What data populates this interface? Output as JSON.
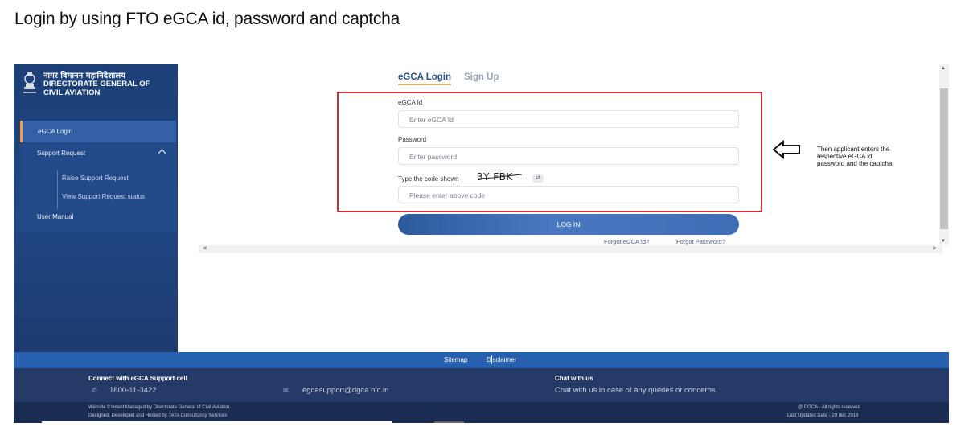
{
  "slide_title": "Login by using FTO eGCA id, password and captcha",
  "brand": {
    "hindi": "नागर विमानन महानिदेशालय",
    "line1": "DIRECTORATE GENERAL OF",
    "line2": "CIVIL AVIATION"
  },
  "sidebar": {
    "items": [
      {
        "label": "eGCA Login"
      },
      {
        "label": "Support Request"
      },
      {
        "label": "Raise Support Request"
      },
      {
        "label": "View Support Request status"
      },
      {
        "label": "User Manual"
      }
    ]
  },
  "tabs": {
    "login": "eGCA Login",
    "signup": "Sign Up"
  },
  "form": {
    "id_label": "eGCA Id",
    "id_placeholder": "Enter eGCA Id",
    "password_label": "Password",
    "password_placeholder": "Enter password",
    "captcha_label": "Type the code shown",
    "captcha_code": "3Y FBK",
    "captcha_placeholder": "Please enter above code",
    "login_button": "LOG IN",
    "forgot_id": "Forgot eGCA Id?",
    "forgot_password": "Forgot Password?"
  },
  "annotation": {
    "note": "Then applicant enters the respective eGCA id, password and the captcha"
  },
  "footer": {
    "sitemap": "Sitemap",
    "disclaimer": "Disclaimer",
    "support_heading": "Connect with eGCA Support cell",
    "phone": "1800-11-3422",
    "email": "egcasupport@dgca.nic.in",
    "chat_heading": "Chat with us",
    "chat_text": "Chat with us in case of any queries or concerns.",
    "managed_by": "Website Content Managed by Directorate General of Civil Aviation.",
    "hosted_by": "Designed, Developed and Hosted by TATA Consultancy Services",
    "rights": "@ DGCA - All rights reserved",
    "last_updated": "Last Updated Date - 29 dec 2019"
  },
  "colors": {
    "sidebar": "#214783",
    "highlight_border": "#c8323a",
    "footer_top": "#2860b0",
    "footer_mid": "#253a66",
    "footer_bottom": "#1b2c52"
  }
}
